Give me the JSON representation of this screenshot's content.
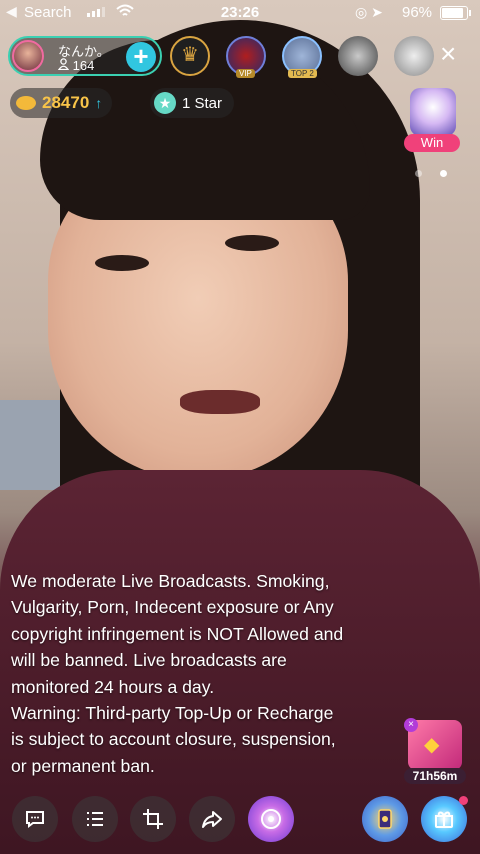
{
  "status_bar": {
    "back_glyph": "◀",
    "carrier": "Search",
    "time": "23:26",
    "battery": "96%",
    "battery_level": 0.96,
    "icons": "◎ ➤"
  },
  "host": {
    "name": "なんか。",
    "viewers": "164",
    "viewers_icon": "person-icon",
    "follow_glyph": "+"
  },
  "viewers_badges": {
    "vip_tag": "VIP",
    "top_tag": "TOP 2"
  },
  "close_glyph": "×",
  "wallet": {
    "coins": "28470",
    "up_glyph": "↑",
    "stars_label": "1 Star",
    "star_glyph": "★"
  },
  "win_widget": {
    "label": "Win"
  },
  "notice": {
    "text": "We moderate Live Broadcasts. Smoking,\nVulgarity, Porn, Indecent exposure or Any\ncopyright infringement is NOT Allowed and\nwill be banned. Live broadcasts are\nmonitored 24 hours a day.\nWarning: Third-party Top-Up or Recharge\nis subject to account closure, suspension,\nor permanent ban."
  },
  "lucky_card": {
    "timer": "71h56m",
    "close_glyph": "×",
    "gem_glyph": "◆"
  },
  "bottom_bar": {
    "icons": [
      "chat-icon",
      "list-icon",
      "crop-icon",
      "share-icon",
      "music-disc-icon",
      "tarot-card-icon",
      "gift-icon"
    ]
  },
  "colors": {
    "accent_teal": "#31c6e0",
    "coin_gold": "#f8c449",
    "win_pink": "#f0417a"
  }
}
